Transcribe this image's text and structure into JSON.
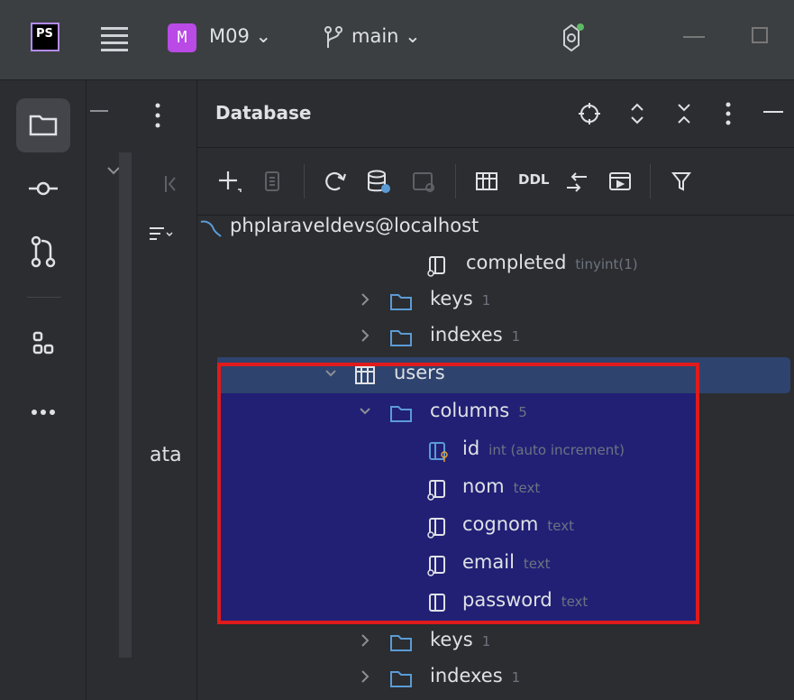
{
  "titlebar": {
    "ps_logo": "PS",
    "project_badge": "M",
    "project_name": "M09 ⌄",
    "branch_name": "main ⌄"
  },
  "left_sidebar": {
    "partial_label": "ata"
  },
  "database_panel": {
    "title": "Database",
    "toolbar": {
      "ddl_label": "DDL"
    },
    "tree": {
      "connection": "phplaraveldevs@localhost",
      "rows": [
        {
          "label": "completed",
          "meta": "tinyint(1)"
        },
        {
          "label": "keys",
          "meta": "1"
        },
        {
          "label": "indexes",
          "meta": "1"
        },
        {
          "label": "users",
          "meta": ""
        },
        {
          "label": "columns",
          "meta": "5"
        },
        {
          "label": "id",
          "meta": "int (auto increment)"
        },
        {
          "label": "nom",
          "meta": "text"
        },
        {
          "label": "cognom",
          "meta": "text"
        },
        {
          "label": "email",
          "meta": "text"
        },
        {
          "label": "password",
          "meta": "text"
        },
        {
          "label": "keys",
          "meta": "1"
        },
        {
          "label": "indexes",
          "meta": "1"
        }
      ]
    }
  },
  "colors": {
    "background": "#2b2d30",
    "selection": "#2e436e",
    "highlight_fill": "#212075",
    "highlight_border": "#e01b1b",
    "folder_icon": "#5b9bd5"
  },
  "icons": [
    "folder-icon",
    "commit-icon",
    "pull-request-icon",
    "structure-icon",
    "more-icon",
    "crosshair-icon",
    "expand-icon",
    "collapse-icon",
    "add-icon",
    "copy-icon",
    "refresh-icon",
    "datasource-icon",
    "console-icon",
    "table-icon",
    "jump-icon",
    "viewer-icon",
    "filter-icon",
    "table-icon",
    "column-icon",
    "primary-key-icon"
  ]
}
